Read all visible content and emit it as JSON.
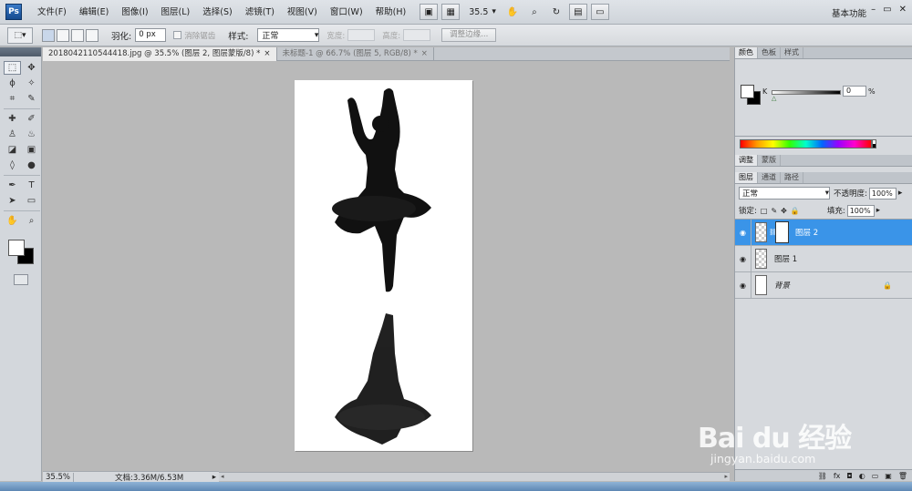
{
  "app": {
    "logo": "Ps",
    "workspace": "基本功能"
  },
  "menu": [
    "文件(F)",
    "编辑(E)",
    "图像(I)",
    "图层(L)",
    "选择(S)",
    "滤镜(T)",
    "视图(V)",
    "窗口(W)",
    "帮助(H)"
  ],
  "menubar": {
    "zoom": "35.5"
  },
  "window_controls": {
    "minimize": "–",
    "restore": "▭",
    "close": "✕"
  },
  "options": {
    "feather_label": "羽化:",
    "feather_value": "0 px",
    "antialias_label": "消除锯齿",
    "style_label": "样式:",
    "style_value": "正常",
    "width_label": "宽度:",
    "height_label": "高度:",
    "refine_label": "调整边缘..."
  },
  "tabs": [
    {
      "label": "2018042110544418.jpg @ 35.5% (图层 2, 图层蒙版/8) *",
      "close": "×"
    },
    {
      "label": "未标题-1 @ 66.7% (图层 5, RGB/8) *",
      "close": "×"
    }
  ],
  "status": {
    "zoom": "35.5%",
    "doc": "文档:3.36M/6.53M"
  },
  "color_panel": {
    "tabs": [
      "颜色",
      "色板",
      "样式"
    ],
    "channel": "K",
    "value": "0",
    "unit": "%"
  },
  "adjust_tabs": [
    "调整",
    "蒙版"
  ],
  "layers_panel": {
    "tabs": [
      "图层",
      "通道",
      "路径"
    ],
    "blend_mode": "正常",
    "opacity_label": "不透明度:",
    "opacity": "100%",
    "lock_label": "锁定:",
    "fill_label": "填充:",
    "fill": "100%",
    "layers": [
      {
        "name": "图层 2",
        "selected": true
      },
      {
        "name": "图层 1",
        "selected": false
      },
      {
        "name": "背景",
        "selected": false
      }
    ]
  },
  "watermark": {
    "brand": "Bai du 经验",
    "url": "jingyan.baidu.com"
  },
  "colors": {
    "accent": "#3a94e8",
    "canvas": "#b9b9b9"
  }
}
